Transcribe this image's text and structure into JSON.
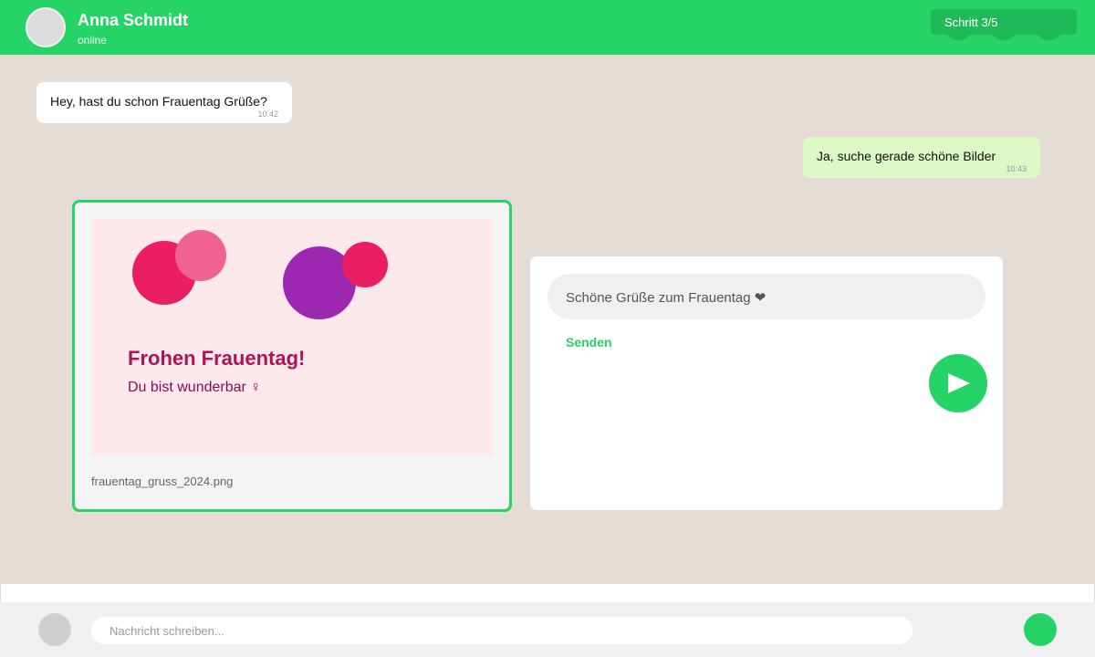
{
  "header": {
    "contact_name": "Anna Schmidt",
    "status": "online",
    "step_label": "Schritt 3/5"
  },
  "messages": [
    {
      "direction": "incoming",
      "text": "Hey, hast du schon Frauentag Grüße?",
      "time": "10:42"
    },
    {
      "direction": "outgoing",
      "text": "Ja, suche gerade schöne Bilder",
      "time": "10:43"
    }
  ],
  "image_card": {
    "greeting_title": "Frohen Frauentag!",
    "greeting_subtitle": "Du bist wunderbar ♀",
    "filename": "frauentag_gruss_2024.png"
  },
  "compose": {
    "message_text": "Schöne Grüße zum Frauentag ❤",
    "send_label": "Senden"
  },
  "bottom_bar": {
    "input_placeholder": "Nachricht schreiben..."
  },
  "colors": {
    "accent": "#25d366",
    "chat_background": "#e5ddd5",
    "outgoing_bubble": "#dcf8c6",
    "greeting_title": "#ad1457"
  }
}
